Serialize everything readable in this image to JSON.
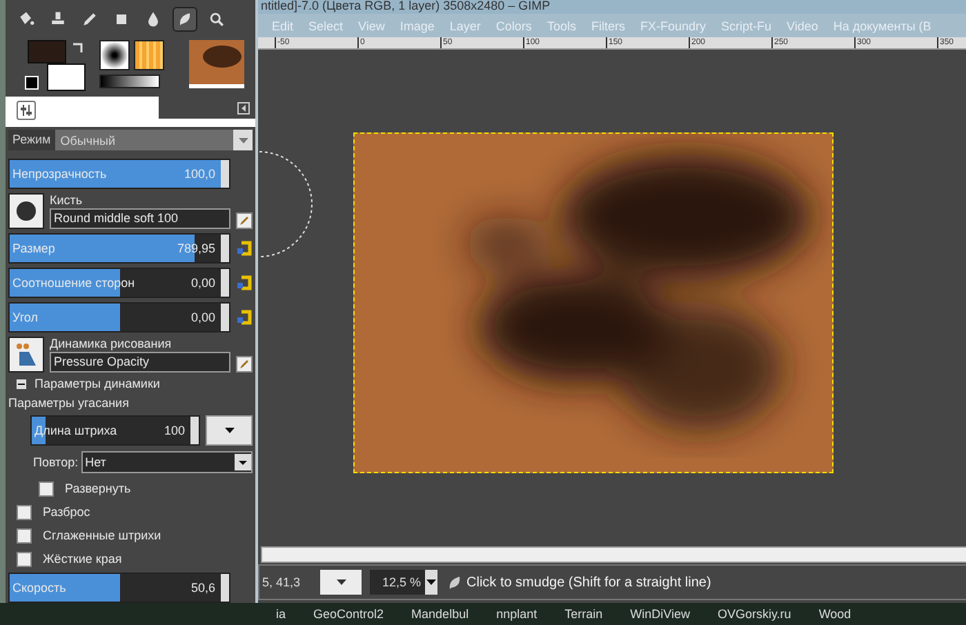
{
  "window": {
    "title": "ntitled]-7.0 (Цвета RGB, 1 layer) 3508x2480 – GIMP"
  },
  "menu": [
    "Edit",
    "Select",
    "View",
    "Image",
    "Layer",
    "Colors",
    "Tools",
    "Filters",
    "FX-Foundry",
    "Script-Fu",
    "Video",
    "На документы (B"
  ],
  "ruler": [
    "-50",
    "0",
    "50",
    "100",
    "150",
    "200",
    "250",
    "300",
    "350"
  ],
  "toolbox": {
    "tools": [
      {
        "selected": false
      },
      {
        "selected": false
      },
      {
        "selected": false
      },
      {
        "selected": false
      },
      {
        "selected": false
      },
      {
        "selected": true
      },
      {
        "selected": false
      }
    ]
  },
  "tool_options": {
    "mode": {
      "label": "Режим",
      "value": "Обычный"
    },
    "rows": [
      {
        "kind": "slider",
        "label": "Непрозрачность",
        "value": "100,0",
        "level": 1.0
      },
      {
        "kind": "brush",
        "label": "Кисть",
        "value": "Round  middle soft 100"
      },
      {
        "kind": "slider-reset",
        "label": "Размер",
        "value": "789,95",
        "level": 0.84
      },
      {
        "kind": "slider-reset",
        "label": "Соотношение сторон",
        "value": "0,00",
        "level": 0.5
      },
      {
        "kind": "slider-reset",
        "label": "Угол",
        "value": "0,00",
        "level": 0.5
      },
      {
        "kind": "dynamics",
        "label": "Динамика рисования",
        "value": "Pressure Opacity"
      },
      {
        "kind": "expander",
        "label": "Параметры динамики",
        "expanded": true,
        "children": [
          {
            "kind": "group",
            "label": "Параметры угасания",
            "children": [
              {
                "kind": "slider-menu",
                "label": "Длина штриха",
                "value": "100",
                "level": 0.08
              },
              {
                "kind": "combo",
                "label": "Повтор:",
                "value": "Нет"
              },
              {
                "kind": "checkbox",
                "label": "Развернуть",
                "checked": false
              }
            ]
          }
        ]
      },
      {
        "kind": "checkbox",
        "label": "Разброс",
        "checked": false
      },
      {
        "kind": "checkbox",
        "label": "Сглаженные штрихи",
        "checked": false
      },
      {
        "kind": "checkbox",
        "label": "Жёсткие края",
        "checked": false
      },
      {
        "kind": "slider",
        "label": "Скорость",
        "value": "50,6",
        "level": 0.5
      }
    ]
  },
  "status_bar": {
    "coordinates": "5, 41,3",
    "zoom": "12,5 %",
    "message": "Click to smudge (Shift for a straight line)"
  },
  "taskbar": [
    "ia",
    "GeoControl2",
    "Mandelbul",
    "nnplant",
    "Terrain",
    "WinDiView",
    "OVGorskiy.ru",
    "Wood"
  ]
}
